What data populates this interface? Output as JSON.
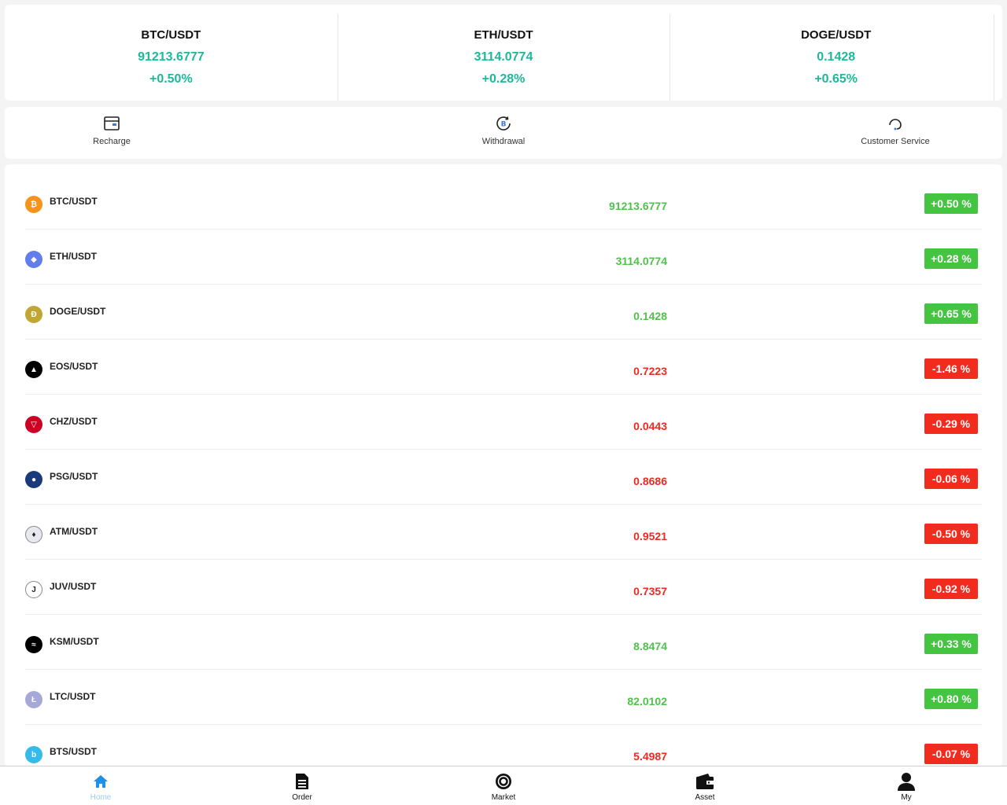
{
  "tickers": [
    {
      "pair": "BTC/USDT",
      "price": "91213.6777",
      "change": "+0.50%"
    },
    {
      "pair": "ETH/USDT",
      "price": "3114.0774",
      "change": "+0.28%"
    },
    {
      "pair": "DOGE/USDT",
      "price": "0.1428",
      "change": "+0.65%"
    }
  ],
  "actions": {
    "recharge": "Recharge",
    "withdrawal": "Withdrawal",
    "customer_service": "Customer Service"
  },
  "colors": {
    "ticker_green": "#1bb99a",
    "up": "#45c442",
    "down": "#f22b1f",
    "active_tab": "#1e90e6"
  },
  "market": [
    {
      "pair": "BTC/USDT",
      "price": "91213.6777",
      "change": "+0.50 %",
      "trend": "up",
      "icon": "btc-icon",
      "icon_color": "#f7931a",
      "glyph": "₿"
    },
    {
      "pair": "ETH/USDT",
      "price": "3114.0774",
      "change": "+0.28 %",
      "trend": "up",
      "icon": "eth-icon",
      "icon_color": "#627eea",
      "glyph": "◆"
    },
    {
      "pair": "DOGE/USDT",
      "price": "0.1428",
      "change": "+0.65 %",
      "trend": "up",
      "icon": "doge-icon",
      "icon_color": "#c2a633",
      "glyph": "Ð"
    },
    {
      "pair": "EOS/USDT",
      "price": "0.7223",
      "change": "-1.46 %",
      "trend": "down",
      "icon": "eos-icon",
      "icon_color": "#000000",
      "glyph": "▲"
    },
    {
      "pair": "CHZ/USDT",
      "price": "0.0443",
      "change": "-0.29 %",
      "trend": "down",
      "icon": "chz-icon",
      "icon_color": "#cd0124",
      "glyph": "▽"
    },
    {
      "pair": "PSG/USDT",
      "price": "0.8686",
      "change": "-0.06 %",
      "trend": "down",
      "icon": "psg-icon",
      "icon_color": "#1a3a7a",
      "glyph": "●"
    },
    {
      "pair": "ATM/USDT",
      "price": "0.9521",
      "change": "-0.50 %",
      "trend": "down",
      "icon": "atm-icon",
      "icon_color": "#e8e8f0",
      "glyph": "♦"
    },
    {
      "pair": "JUV/USDT",
      "price": "0.7357",
      "change": "-0.92 %",
      "trend": "down",
      "icon": "juv-icon",
      "icon_color": "#ffffff",
      "glyph": "J"
    },
    {
      "pair": "KSM/USDT",
      "price": "8.8474",
      "change": "+0.33 %",
      "trend": "up",
      "icon": "ksm-icon",
      "icon_color": "#000000",
      "glyph": "≈"
    },
    {
      "pair": "LTC/USDT",
      "price": "82.0102",
      "change": "+0.80 %",
      "trend": "up",
      "icon": "ltc-icon",
      "icon_color": "#a6a9d8",
      "glyph": "Ł"
    },
    {
      "pair": "BTS/USDT",
      "price": "5.4987",
      "change": "-0.07 %",
      "trend": "down",
      "icon": "bts-icon",
      "icon_color": "#35baeb",
      "glyph": "b"
    }
  ],
  "tabs": [
    {
      "label": "Home",
      "icon": "home-icon",
      "active": true
    },
    {
      "label": "Order",
      "icon": "order-icon",
      "active": false
    },
    {
      "label": "Market",
      "icon": "market-icon",
      "active": false
    },
    {
      "label": "Asset",
      "icon": "wallet-icon",
      "active": false
    },
    {
      "label": "My",
      "icon": "user-icon",
      "active": false
    }
  ]
}
